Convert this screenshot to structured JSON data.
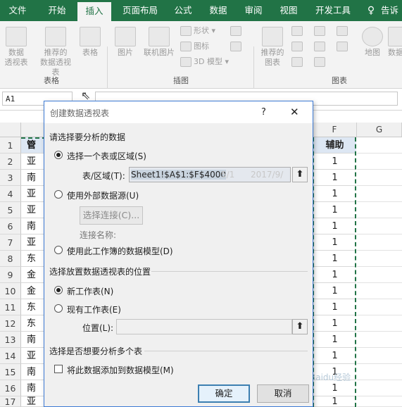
{
  "ribbon_tabs": [
    "文件",
    "开始",
    "插入",
    "页面布局",
    "公式",
    "数据",
    "审阅",
    "视图",
    "开发工具",
    "告诉"
  ],
  "ribbon": {
    "tables_group": "表格",
    "pivot_table": [
      "数据",
      "透视表"
    ],
    "recommended_pivot": [
      "推荐的",
      "数据透视表"
    ],
    "table": "表格",
    "illustrations_group": "插图",
    "picture": "图片",
    "online_picture": "联机图片",
    "shapes": "形状",
    "icons": "图标",
    "model_3d": "3D 模型",
    "charts_group": "图表",
    "recommended_charts": [
      "推荐的",
      "图表"
    ],
    "map": "地图",
    "partial_label": "数据"
  },
  "name_box": "A1",
  "columns": [
    "F",
    "G"
  ],
  "rows": [
    {
      "n": "1",
      "a": "管",
      "f": "辅助"
    },
    {
      "n": "2",
      "a": "亚",
      "f": "1"
    },
    {
      "n": "3",
      "a": "南",
      "f": "1"
    },
    {
      "n": "4",
      "a": "亚",
      "f": "1"
    },
    {
      "n": "5",
      "a": "亚",
      "f": "1"
    },
    {
      "n": "6",
      "a": "南",
      "f": "1"
    },
    {
      "n": "7",
      "a": "亚",
      "f": "1"
    },
    {
      "n": "8",
      "a": "东",
      "f": "1"
    },
    {
      "n": "9",
      "a": "金",
      "f": "1"
    },
    {
      "n": "10",
      "a": "金",
      "f": "1"
    },
    {
      "n": "11",
      "a": "东",
      "f": "1"
    },
    {
      "n": "12",
      "a": "东",
      "f": "1"
    },
    {
      "n": "13",
      "a": "南",
      "f": "1"
    },
    {
      "n": "14",
      "a": "亚",
      "f": "1"
    },
    {
      "n": "15",
      "a": "南",
      "f": "1"
    },
    {
      "n": "16",
      "a": "南",
      "f": "1"
    },
    {
      "n": "17",
      "a": "亚",
      "f": "1"
    }
  ],
  "dialog": {
    "title": "创建数据透视表",
    "help": "?",
    "close": "✕",
    "section_data": "请选择要分析的数据",
    "opt_select_range": "选择一个表或区域(S)",
    "range_label": "表/区域(T):",
    "range_value": "Sheet1!$A$1:$F$4000",
    "range_ghost_1": "5/1",
    "range_ghost_2": "2017/9/",
    "opt_external": "使用外部数据源(U)",
    "choose_connection": "选择连接(C)...",
    "connection_name": "连接名称:",
    "opt_data_model": "使用此工作簿的数据模型(D)",
    "section_location": "选择放置数据透视表的位置",
    "opt_new_sheet": "新工作表(N)",
    "opt_existing_sheet": "现有工作表(E)",
    "location_label": "位置(L):",
    "location_value": "",
    "section_multi": "选择是否想要分析多个表",
    "add_to_model": "将此数据添加到数据模型(M)",
    "ok": "确定",
    "cancel": "取消"
  },
  "watermark": "Baidu经验"
}
